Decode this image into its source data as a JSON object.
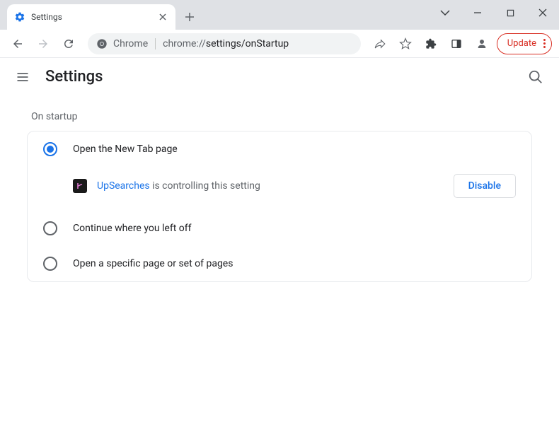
{
  "window": {
    "tab_title": "Settings"
  },
  "toolbar": {
    "chrome_label": "Chrome",
    "url_scheme": "chrome://",
    "url_path": "settings/onStartup",
    "update_label": "Update"
  },
  "header": {
    "title": "Settings"
  },
  "section": {
    "label": "On startup",
    "options": [
      {
        "label": "Open the New Tab page",
        "checked": true
      },
      {
        "label": "Continue where you left off",
        "checked": false
      },
      {
        "label": "Open a specific page or set of pages",
        "checked": false
      }
    ],
    "notice": {
      "extension_name": "UpSearches",
      "text_suffix": " is controlling this setting",
      "disable_label": "Disable"
    }
  }
}
